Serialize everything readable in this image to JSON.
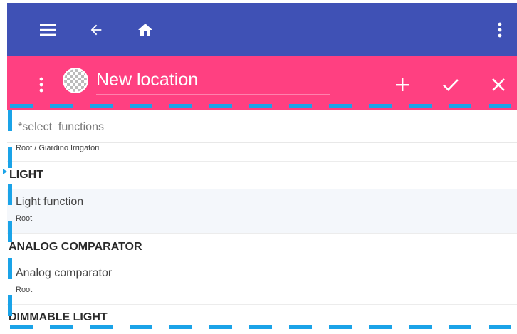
{
  "appbar": {
    "menu_icon": "menu-icon",
    "back_icon": "arrow-back-icon",
    "home_icon": "home-icon",
    "more_icon": "more-vert-icon",
    "color": "#3f51b5"
  },
  "toolbar": {
    "title_value": "New location",
    "color": "#ff4081",
    "add_icon": "plus-icon",
    "confirm_icon": "check-icon",
    "close_icon": "close-icon"
  },
  "filter": {
    "placeholder": "*select_functions",
    "path": "Root / Giardino Irrigatori"
  },
  "groups": [
    {
      "header": "LIGHT",
      "items": [
        {
          "name": "Light function",
          "sub": "Root"
        }
      ]
    },
    {
      "header": "ANALOG COMPARATOR",
      "items": [
        {
          "name": "Analog comparator",
          "sub": "Root"
        }
      ]
    },
    {
      "header": "DIMMABLE LIGHT",
      "items": []
    }
  ]
}
